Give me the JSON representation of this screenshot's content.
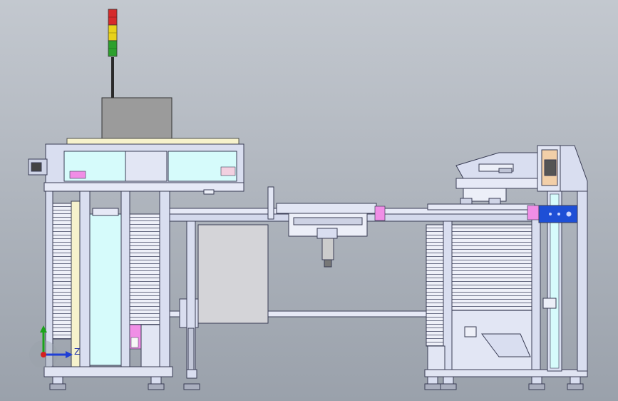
{
  "viewport": {
    "background_top": "#c3c8cf",
    "background_bottom": "#9aa1ab"
  },
  "model": {
    "signal_tower_colors": [
      "#d62a2a",
      "#e8d21a",
      "#2ca02c"
    ],
    "frame_color": "#d9def0",
    "frame_stroke": "#3a3d55",
    "glass_color": "#d6fbfb",
    "pink_block_color": "#f08ee6",
    "blue_block_color": "#1e4fd6",
    "control_box_color": "#9b9b9b"
  },
  "triad": {
    "z_label": "Z",
    "x_axis_color": "#1f3fd6",
    "y_axis_color": "#1aa31a",
    "origin_color": "#d42020"
  }
}
